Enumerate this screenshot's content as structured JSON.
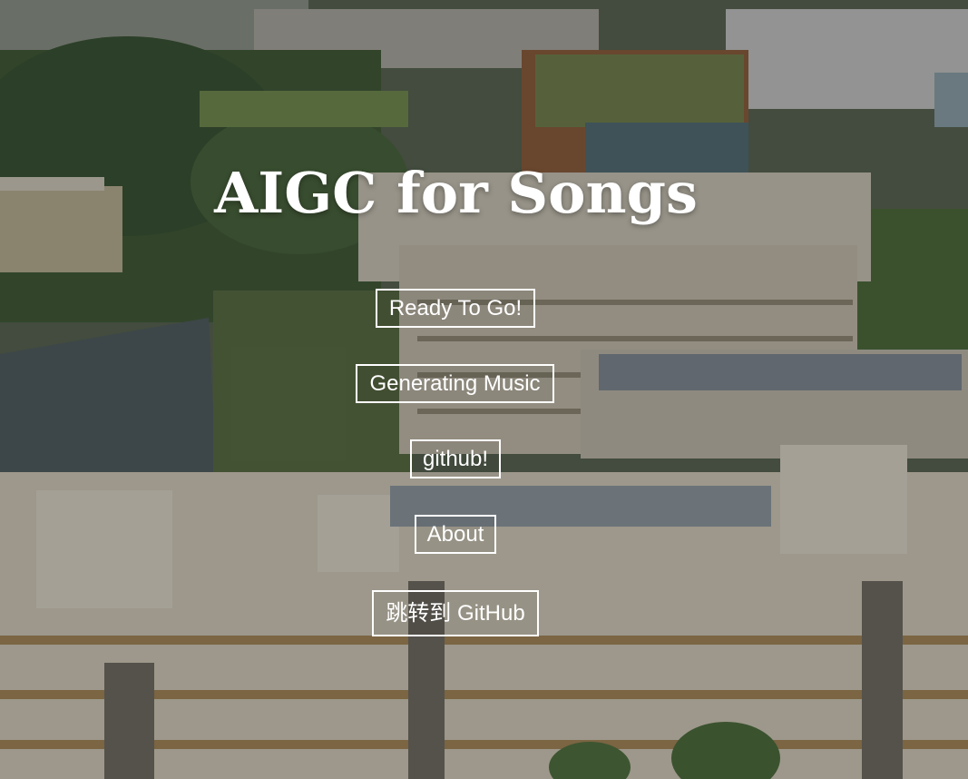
{
  "hero": {
    "title": "AIGC for Songs",
    "background_description_colors": {
      "sky_tint": "#6b6f68",
      "greenery": "#3f5a34",
      "building_light": "#cfc9bb",
      "building_accent": "#b88a3e",
      "water": "#4c5a60"
    }
  },
  "buttons": {
    "ready": "Ready To Go!",
    "generating": "Generating Music",
    "github": "github!",
    "about": "About",
    "jump_github": "跳转到 GitHub"
  },
  "colors": {
    "text": "#ffffff",
    "button_border": "#ffffff"
  }
}
